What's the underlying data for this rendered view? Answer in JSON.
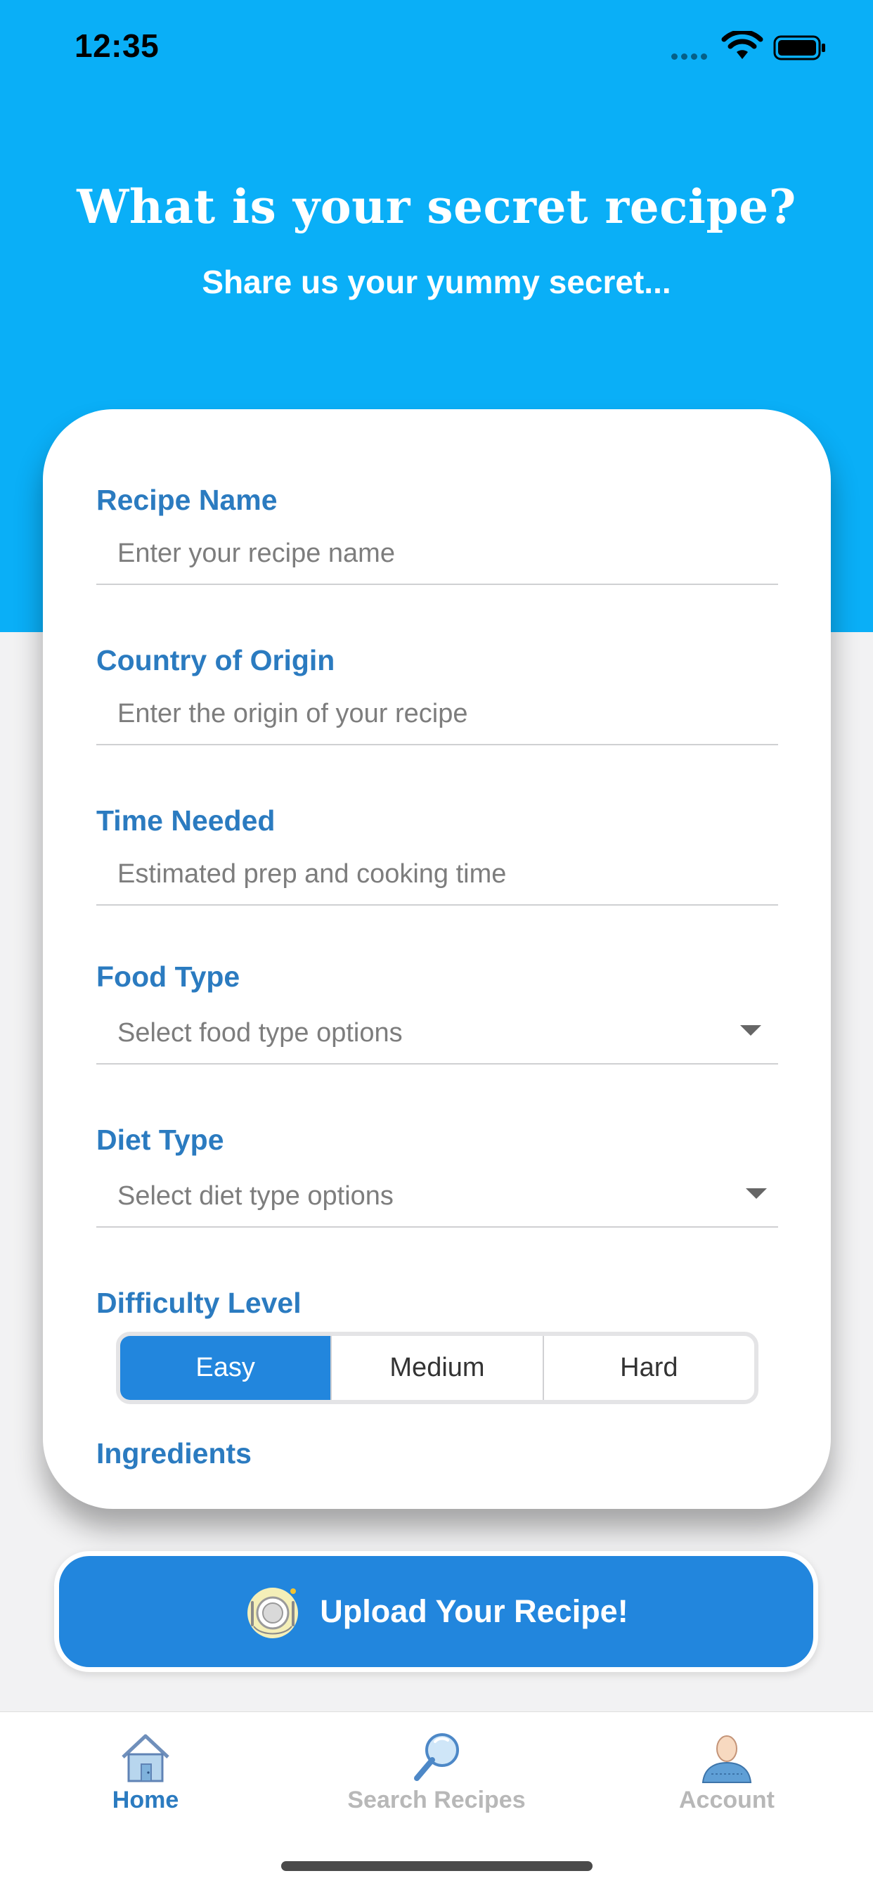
{
  "status_bar": {
    "time": "12:35",
    "signal_icon": "signal-icon",
    "wifi_icon": "wifi-icon",
    "battery_icon": "battery-icon"
  },
  "colors": {
    "header_blue": "#0aaff7",
    "accent_blue": "#2286dd",
    "label_blue": "#2b7bc0",
    "background": "#f2f2f3"
  },
  "header": {
    "title": "What is your secret recipe?",
    "subtitle": "Share us your yummy secret..."
  },
  "form": {
    "recipe_name": {
      "label": "Recipe Name",
      "placeholder": "Enter your recipe name",
      "value": ""
    },
    "country": {
      "label": "Country of Origin",
      "placeholder": "Enter the origin of your recipe",
      "value": ""
    },
    "time_needed": {
      "label": "Time Needed",
      "placeholder": "Estimated prep and cooking time",
      "value": ""
    },
    "food_type": {
      "label": "Food Type",
      "placeholder": "Select food type options",
      "icon": "chevron-down-icon"
    },
    "diet_type": {
      "label": "Diet Type",
      "placeholder": "Select diet type options",
      "icon": "chevron-down-icon"
    },
    "difficulty": {
      "label": "Difficulty Level",
      "options": [
        "Easy",
        "Medium",
        "Hard"
      ],
      "selected": "Easy"
    },
    "ingredients_label": "Ingredients"
  },
  "upload_button": {
    "label": "Upload Your Recipe!",
    "icon": "plate-icon"
  },
  "tab_bar": {
    "tabs": [
      {
        "label": "Home",
        "icon": "home-icon",
        "active": true
      },
      {
        "label": "Search Recipes",
        "icon": "magnifier-icon",
        "active": false
      },
      {
        "label": "Account",
        "icon": "person-icon",
        "active": false
      }
    ]
  }
}
